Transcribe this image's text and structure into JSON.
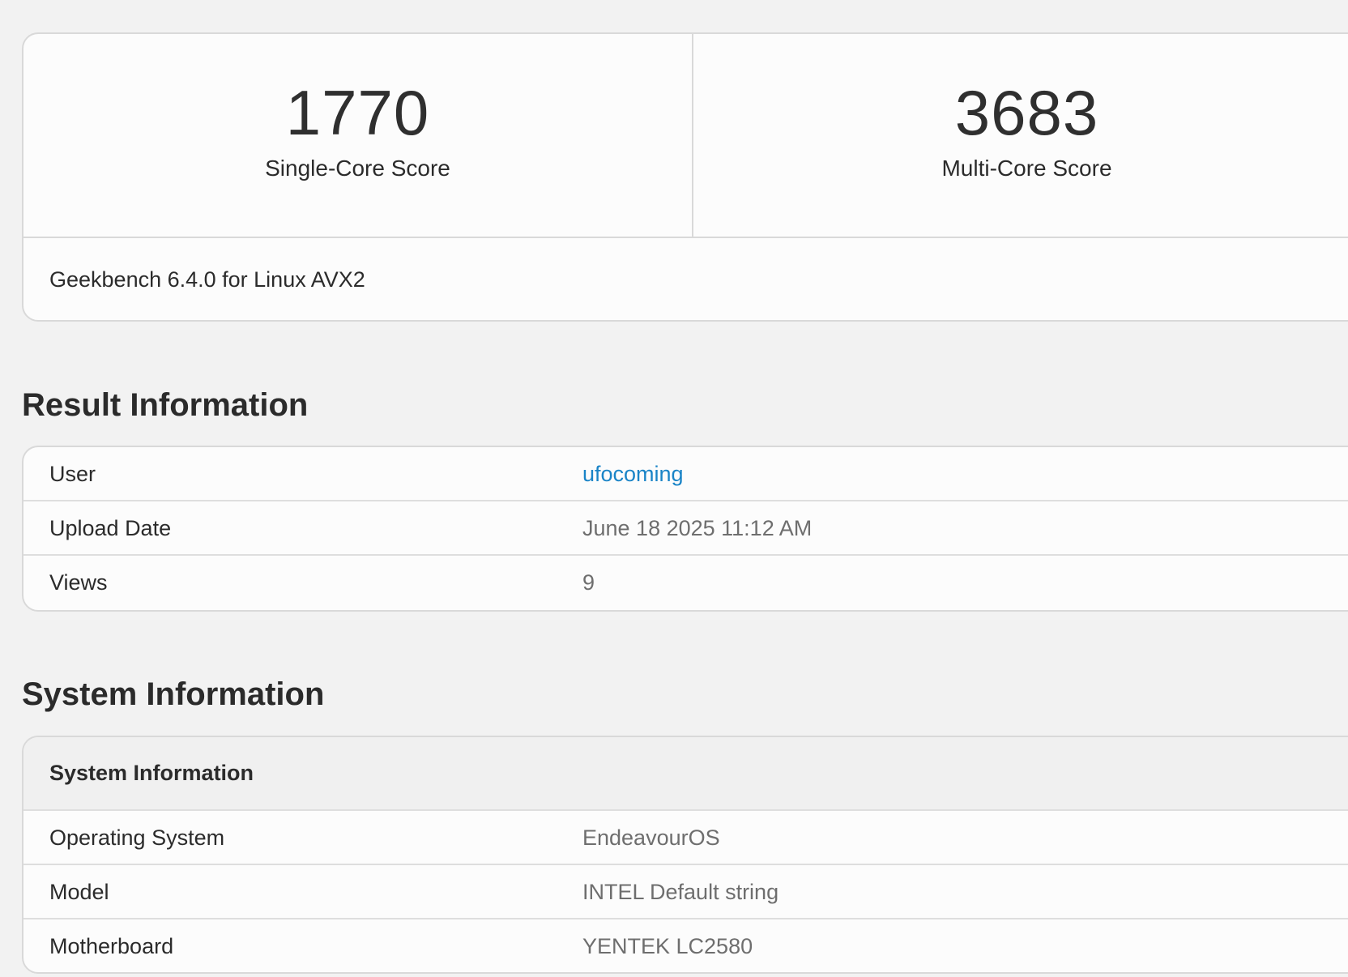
{
  "scores": {
    "single_core": {
      "value": "1770",
      "label": "Single-Core Score"
    },
    "multi_core": {
      "value": "3683",
      "label": "Multi-Core Score"
    },
    "version": "Geekbench 6.4.0 for Linux AVX2"
  },
  "result_information": {
    "title": "Result Information",
    "rows": [
      {
        "label": "User",
        "value": "ufocoming"
      },
      {
        "label": "Upload Date",
        "value": "June 18 2025 11:12 AM"
      },
      {
        "label": "Views",
        "value": "9"
      }
    ]
  },
  "system_information": {
    "title": "System Information",
    "table_header": "System Information",
    "rows": [
      {
        "label": "Operating System",
        "value": "EndeavourOS"
      },
      {
        "label": "Model",
        "value": "INTEL Default string"
      },
      {
        "label": "Motherboard",
        "value": "YENTEK LC2580"
      }
    ]
  },
  "colors": {
    "background": "#f2f2f2",
    "card": "#fcfcfc",
    "link": "#1a84c7",
    "muted_value": "#6e6e6e"
  }
}
